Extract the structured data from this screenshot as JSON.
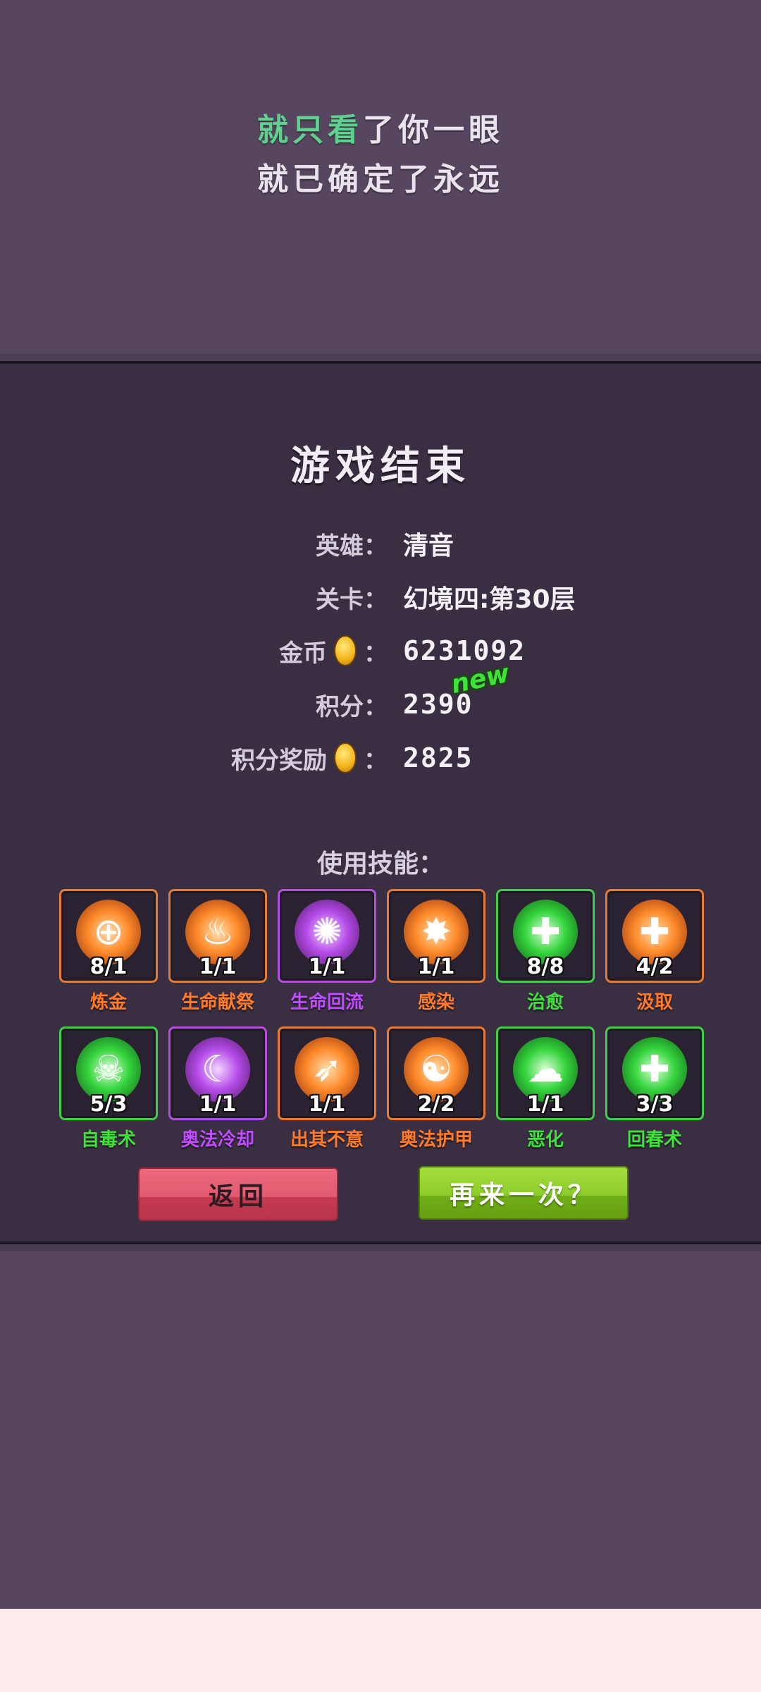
{
  "lyrics": {
    "line1_highlight": "就只看",
    "line1_rest": "了你一眼",
    "line2": "就已确定了永远"
  },
  "game_over": {
    "title": "游戏结束",
    "hero_label": "英雄：",
    "hero_value": "清音",
    "stage_label": "关卡：",
    "stage_value": "幻境四:第30层",
    "gold_label": "金币",
    "gold_colon": "：",
    "gold_value": "6231092",
    "score_label": "积分：",
    "score_value": "2390",
    "new_badge": "new",
    "bonus_label": "积分奖励",
    "bonus_colon": "：",
    "bonus_value": "2825",
    "skills_title": "使用技能：",
    "skills": [
      {
        "name": "炼金",
        "count": "8/1",
        "color": "#ff7a2a",
        "icon": "crosshair-icon",
        "glyph": "⊕",
        "theme": "orange"
      },
      {
        "name": "生命献祭",
        "count": "1/1",
        "color": "#ff7a2a",
        "icon": "fire-icon",
        "glyph": "♨",
        "theme": "orange"
      },
      {
        "name": "生命回流",
        "count": "1/1",
        "color": "#c04dff",
        "icon": "spirit-icon",
        "glyph": "✺",
        "theme": "purple"
      },
      {
        "name": "感染",
        "count": "1/1",
        "color": "#ff7a2a",
        "icon": "splat-icon",
        "glyph": "✸",
        "theme": "orange"
      },
      {
        "name": "治愈",
        "count": "8/8",
        "color": "#3fe23a",
        "icon": "heal-drop-icon",
        "glyph": "✚",
        "theme": "green"
      },
      {
        "name": "汲取",
        "count": "4/2",
        "color": "#ff7a2a",
        "icon": "drain-icon",
        "glyph": "✚",
        "theme": "orange"
      },
      {
        "name": "自毒术",
        "count": "5/3",
        "color": "#3fe23a",
        "icon": "skull-icon",
        "glyph": "☠",
        "theme": "green"
      },
      {
        "name": "奥法冷却",
        "count": "1/1",
        "color": "#c04dff",
        "icon": "moon-star-icon",
        "glyph": "☾",
        "theme": "purple"
      },
      {
        "name": "出其不意",
        "count": "1/1",
        "color": "#ff7a2a",
        "icon": "dash-icon",
        "glyph": "➶",
        "theme": "orange"
      },
      {
        "name": "奥法护甲",
        "count": "2/2",
        "color": "#ff7a2a",
        "icon": "meditate-icon",
        "glyph": "☯",
        "theme": "orange"
      },
      {
        "name": "恶化",
        "count": "1/1",
        "color": "#3fe23a",
        "icon": "slime-icon",
        "glyph": "☁",
        "theme": "green"
      },
      {
        "name": "回春术",
        "count": "3/3",
        "color": "#3fe23a",
        "icon": "regen-icon",
        "glyph": "✚",
        "theme": "green"
      }
    ],
    "back_label": "返回",
    "retry_label": "再来一次？"
  }
}
